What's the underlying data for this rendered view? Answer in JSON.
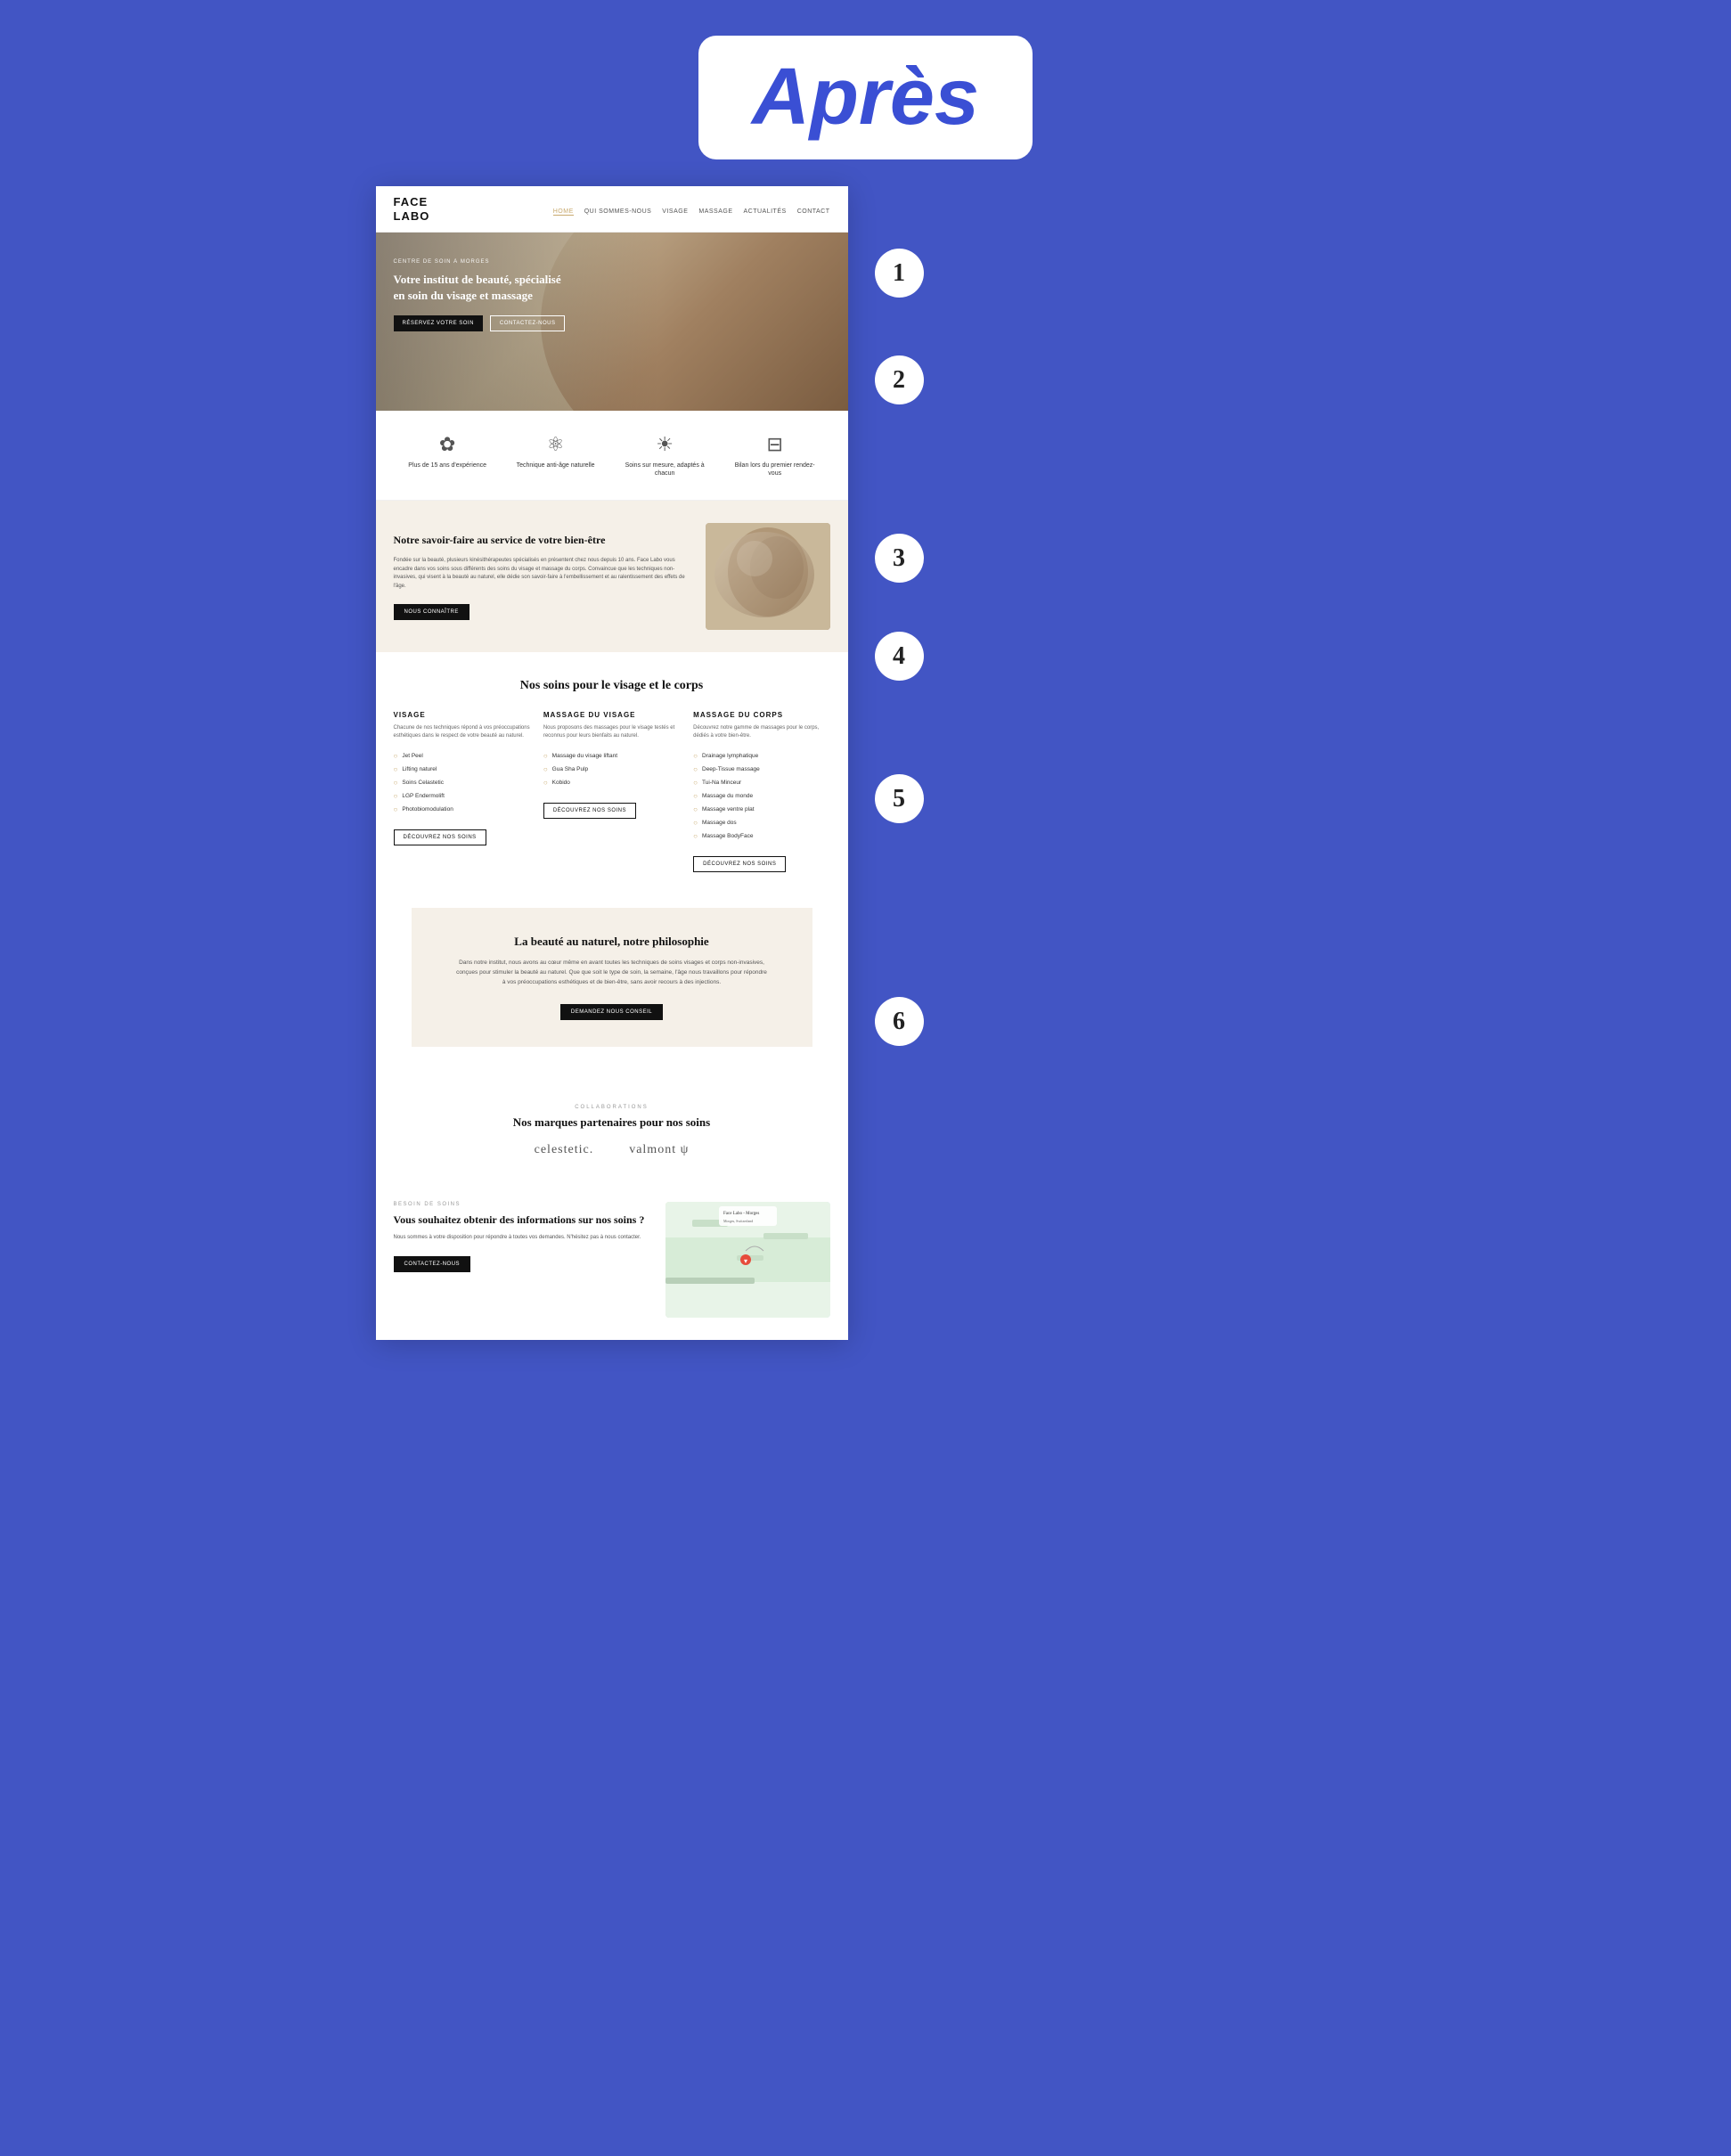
{
  "header": {
    "badge_text": "Après"
  },
  "numbered_labels": [
    "1",
    "2",
    "3",
    "4",
    "5",
    "6"
  ],
  "nav": {
    "logo_line1": "FACE",
    "logo_line2": "LABO",
    "links": [
      {
        "label": "HOME",
        "active": true
      },
      {
        "label": "QUI SOMMES-NOUS",
        "active": false
      },
      {
        "label": "VISAGE",
        "active": false
      },
      {
        "label": "MASSAGE",
        "active": false
      },
      {
        "label": "ACTUALITÉS",
        "active": false
      },
      {
        "label": "CONTACT",
        "active": false
      }
    ]
  },
  "hero": {
    "eyebrow": "CENTRE DE SOIN À MORGES",
    "title": "Votre institut de beauté, spécialisé en soin du visage et massage",
    "btn_reserve": "RÉSERVEZ VOTRE SOIN",
    "btn_contact": "CONTACTEZ-NOUS"
  },
  "features": [
    {
      "icon": "✿",
      "text": "Plus de 15 ans d'expérience"
    },
    {
      "icon": "⚛",
      "text": "Technique anti-âge naturelle"
    },
    {
      "icon": "☀",
      "text": "Soins sur mesure, adaptés à chacun"
    },
    {
      "icon": "⊟",
      "text": "Bilan lors du premier rendez-vous"
    }
  ],
  "about": {
    "title": "Notre savoir-faire au service de votre bien-être",
    "body": "Fondée sur la beauté, plusieurs kinésithérapeutes spécialisés en présentent chez nous depuis 10 ans. Face Labo vous encadre dans vos soins sous différents des soins du visage et massage du corps. Convaincue que les techniques non-invasives, qui visent à la beauté au naturel, elle dédie son savoir-faire à l'embellissement et au ralentissement des effets de l'âge.",
    "btn_label": "NOUS CONNAÎTRE"
  },
  "services": {
    "section_title": "Nos soins pour le visage et le corps",
    "columns": [
      {
        "title": "VISAGE",
        "desc": "Chacune de nos techniques répond à vos préoccupations esthétiques dans le respect de votre beauté au naturel.",
        "items": [
          "Jet Peel",
          "Lifting naturel",
          "Soins Celastetic",
          "LGP Endermolift",
          "Photobiomodulation"
        ],
        "btn": "DÉCOUVREZ NOS SOINS"
      },
      {
        "title": "MASSAGE DU VISAGE",
        "desc": "Nous proposons des massages pour le visage testés et reconnus pour leurs bienfaits au naturel.",
        "items": [
          "Massage du visage liftant",
          "Gua Sha Pulp",
          "Kobido"
        ],
        "btn": "DÉCOUVREZ NOS SOINS"
      },
      {
        "title": "MASSAGE DU CORPS",
        "desc": "Découvrez notre gamme de massages pour le corps, dédiés à votre bien-être.",
        "items": [
          "Drainage lymphatique",
          "Deep-Tissue massage",
          "Tui-Na Minceur",
          "Massage du monde",
          "Massage ventre plat",
          "Massage dos",
          "Massage BodyFace"
        ],
        "btn": "DÉCOUVREZ NOS SOINS"
      }
    ]
  },
  "philosophy": {
    "title": "La beauté au naturel, notre philosophie",
    "body": "Dans notre institut, nous avons au cœur même en avant toutes les techniques de soins visages et corps non-invasives, conçues pour stimuler la beauté au naturel. Que que soit le type de soin, la semaine, l'âge nous travaillons pour répondre à vos préoccupations esthétiques et de bien-être, sans avoir recours à des injections.",
    "btn_label": "DEMANDEZ NOUS CONSEIL"
  },
  "partners": {
    "eyebrow": "COLLABORATIONS",
    "title": "Nos marques partenaires pour nos soins",
    "logos": [
      "celestetic.",
      "valmont ψ"
    ]
  },
  "contact": {
    "eyebrow": "BESOIN DE SOINS",
    "title": "Vous souhaitez obtenir des informations sur nos soins ?",
    "body": "Nous sommes à votre disposition pour répondre à toutes vos demandes. N'hésitez pas à nous contacter.",
    "btn_label": "CONTACTEZ-NOUS",
    "map_label": "Face Labo - Morges"
  }
}
